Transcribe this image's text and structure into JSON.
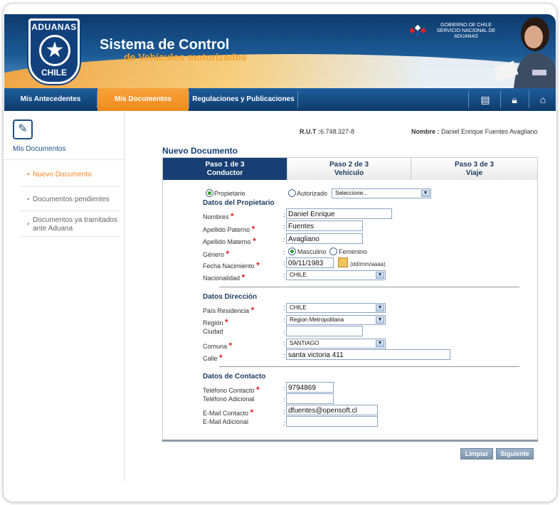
{
  "header": {
    "logo_top": "ADUANAS",
    "logo_bottom": "CHILE",
    "title": "Sistema de Control",
    "subtitle": "de Vehículos motorizados",
    "gov_line1": "GOBIERNO DE CHILE",
    "gov_line2": "SERVICIO NACIONAL DE",
    "gov_line3": "ADUANAS"
  },
  "nav": {
    "items": [
      "Mis Antecedentes",
      "Mis Documentos",
      "Regulaciones y Publicaciones"
    ],
    "active_index": 1
  },
  "sidebar": {
    "title": "Mis Documentos",
    "items": [
      "Nuevo Documento",
      "Documentos pendientes",
      "Documentos ya tramitados ante Aduana"
    ],
    "active_index": 0
  },
  "user": {
    "rut_label": "R.U.T :",
    "rut_value": "6.748.327-8",
    "nombre_label": "Nombre :",
    "nombre_value": "Daniel Enrique Fuentes Avagliano"
  },
  "page_title": "Nuevo Documento",
  "steps": [
    {
      "line1": "Paso 1 de 3",
      "line2": "Conductor"
    },
    {
      "line1": "Paso 2 de 3",
      "line2": "Vehículo"
    },
    {
      "line1": "Paso 3 de 3",
      "line2": "Viaje"
    }
  ],
  "owner_type": {
    "option1": "Propietario",
    "option2": "Autorizado",
    "select_value": "Seleccione..."
  },
  "sections": {
    "propietario": "Datos del Propietario",
    "direccion": "Datos Dirección",
    "contacto": "Datos de Contacto"
  },
  "labels": {
    "nombres": "Nombres",
    "apellido_paterno": "Apellido Paterno",
    "apellido_materno": "Apellido Materno",
    "genero": "Género",
    "fecha_nacimiento": "Fecha Nacimiento",
    "nacionalidad": "Nacionalidad",
    "pais": "País Residencia",
    "region": "Región",
    "ciudad": "Ciudad",
    "comuna": "Comuna",
    "calle": "Calle",
    "telefono": "Teléfono Contacto",
    "telefono_adicional": "Teléfono Adicional",
    "email": "E-Mail Contacto",
    "email_adicional": "E-Mail Adicional",
    "masculino": "Masculino",
    "femenino": "Femenino",
    "date_hint": "(dd/mm/aaaa)"
  },
  "values": {
    "nombres": "Daniel Enrique",
    "apellido_paterno": "Fuentes",
    "apellido_materno": "Avagliano",
    "fecha_nacimiento": "09/11/1983",
    "nacionalidad": "CHILE",
    "pais": "CHILE",
    "region": "Region Metropolitana",
    "ciudad": "",
    "comuna": "SANTIAGO",
    "calle": "santa victoria 411",
    "telefono": "9794869",
    "telefono_adicional": "",
    "email": "dfuentes@opensoft.cl",
    "email_adicional": ""
  },
  "buttons": {
    "limpiar": "Limpiar",
    "siguiente": "Siguiente"
  }
}
